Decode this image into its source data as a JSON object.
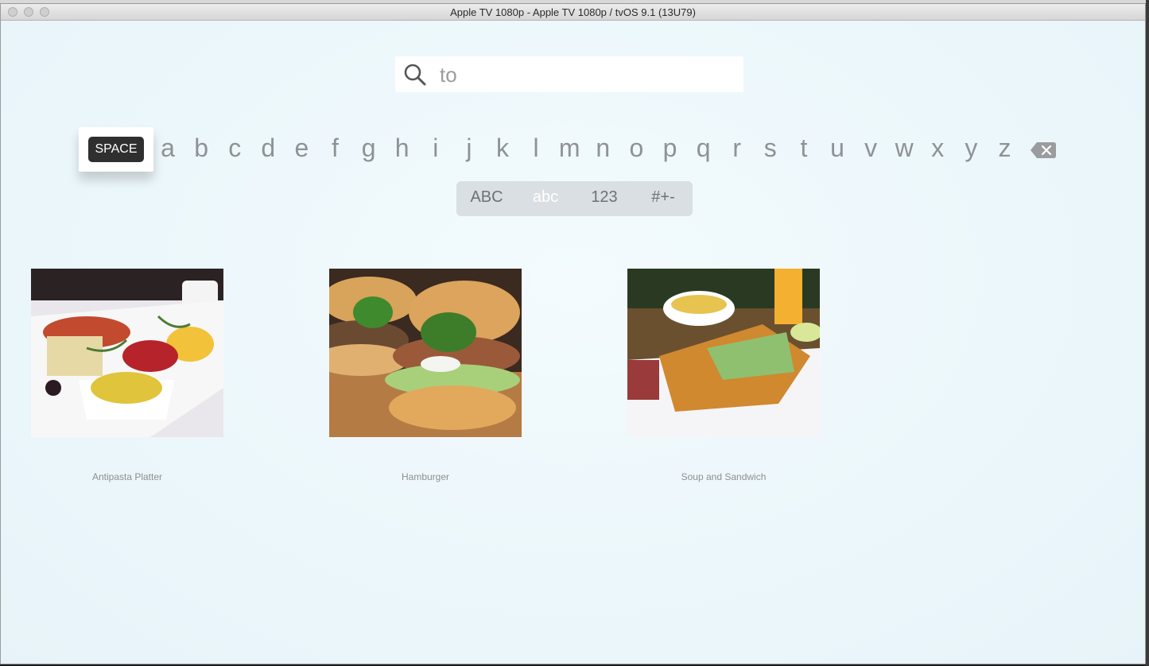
{
  "window": {
    "title": "Apple TV 1080p - Apple TV 1080p / tvOS 9.1 (13U79)"
  },
  "search": {
    "value": "to"
  },
  "keyboard": {
    "space_label": "SPACE",
    "letters": [
      "a",
      "b",
      "c",
      "d",
      "e",
      "f",
      "g",
      "h",
      "i",
      "j",
      "k",
      "l",
      "m",
      "n",
      "o",
      "p",
      "q",
      "r",
      "s",
      "t",
      "u",
      "v",
      "w",
      "x",
      "y",
      "z"
    ],
    "modes": [
      "ABC",
      "abc",
      "123",
      "#+-"
    ],
    "active_mode": "abc"
  },
  "results": [
    {
      "title": "Antipasta Platter"
    },
    {
      "title": "Hamburger"
    },
    {
      "title": "Soup and Sandwich"
    }
  ],
  "colors": {
    "background": "#eef7fb",
    "key_text": "#8f9294",
    "focused_key": "#2f2f2f",
    "mode_bar": "#d9dfe2"
  }
}
